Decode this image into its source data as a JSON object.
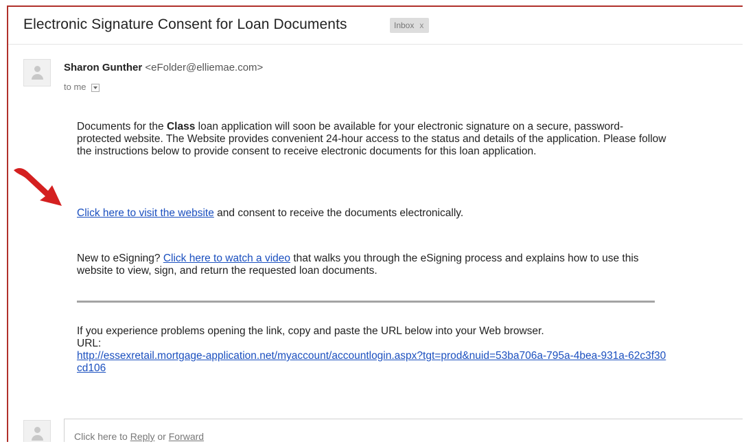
{
  "email": {
    "subject": "Electronic Signature Consent for Loan Documents",
    "label": "Inbox",
    "label_close": "x",
    "sender_name": "Sharon Gunther",
    "sender_email": "<eFolder@elliemae.com>",
    "to": "to me"
  },
  "body": {
    "p1_before": "Documents for the ",
    "p1_bold": "Class",
    "p1_after": " loan application will soon be available for your electronic signature on a secure, password-protected website. The Website provides convenient 24-hour access to the status and details of the application. Please follow the instructions below to provide consent to receive electronic documents for this loan application.",
    "visit_link": "Click here to visit the website",
    "visit_after": " and consent to receive the documents electronically.",
    "video_before": "New to eSigning? ",
    "video_link": "Click here to watch a video",
    "video_after": " that walks you through the eSigning process and explains how to use this website to view, sign, and return the requested loan documents.",
    "problems": "If you experience problems opening the link, copy and paste the URL below into your Web browser.",
    "url_label": "URL:",
    "url": "http://essexretail.mortgage-application.net/myaccount/accountlogin.aspx?tgt=prod&nuid=53ba706a-795a-4bea-931a-62c3f30cd106"
  },
  "reply": {
    "prefix": "Click here to ",
    "reply_link": "Reply",
    "or": " or ",
    "forward_link": "Forward"
  },
  "colors": {
    "frame_border": "#b0302a",
    "link": "#1a4fbf",
    "arrow": "#d42020"
  },
  "icons": [
    "arrow-icon",
    "avatar-icon",
    "dropdown-icon"
  ]
}
